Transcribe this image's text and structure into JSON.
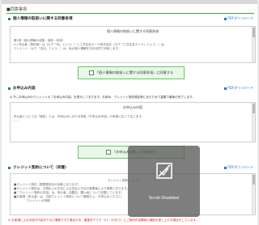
{
  "page": {
    "title": "■同意事項"
  },
  "sections": [
    {
      "title": "個人情報の取扱いに関する同意条項",
      "pdf_label": "PDFダウンロード",
      "doc_title": "個人情報の取扱いに関する同意条項",
      "lines": [
        "第1条（個人情報の収集・保有・利用）",
        "(1) 申込者（契約者）は（以下「私」という。）と三井住友カード株式会社（以下「三井住友カード」という。）は、",
        "  クレジット（以下「当社」という。）は、私の個人情報を次の目的で利用します。"
      ],
      "agree_label": "「個人情報の取扱いに関する同意条項」に同意する"
    },
    {
      "title": "お申込み内容",
      "pdf_label": "PDFダウンロード",
      "description": "以下にお申込みのクレジットの「お申込み内容」を表示しております。お読み、クレジット契約規定等にあらためて重要で最後の完了します。",
      "doc_title": "お申込み内容",
      "lines": [
        "申込者については「個別」とは、本申込みにおける別紙「お申込み内容」の承認に応じて生じます。",
        "……"
      ],
      "agree_label": "「お申込み内容」に同意する"
    },
    {
      "title": "クレジット契約について（同意）",
      "pdf_label": "PDFダウンロード",
      "lines": [
        "クレジット契約について",
        "■クレジット契約（割賦販売法の対象となります）",
        "■クレジット契約は、分割払いの方法による支払い方法の事業者により事業となります。",
        "■「クレジット契約の内容」は、申込者、加盟店、購入者について記載しています。",
        "■お客様（申込者）は、当該クレジット契約について確認の上、お申込みください。",
        "クレジットの特徴"
      ]
    }
  ],
  "footer": {
    "note": "※ お客様による手続き内容が十分に確認できた場合のみ、審査完了です（21・00まで）にご契約内容確認の通知を差し上げる場合がございます。"
  },
  "overlay": {
    "label": "Scroll Disabled"
  }
}
